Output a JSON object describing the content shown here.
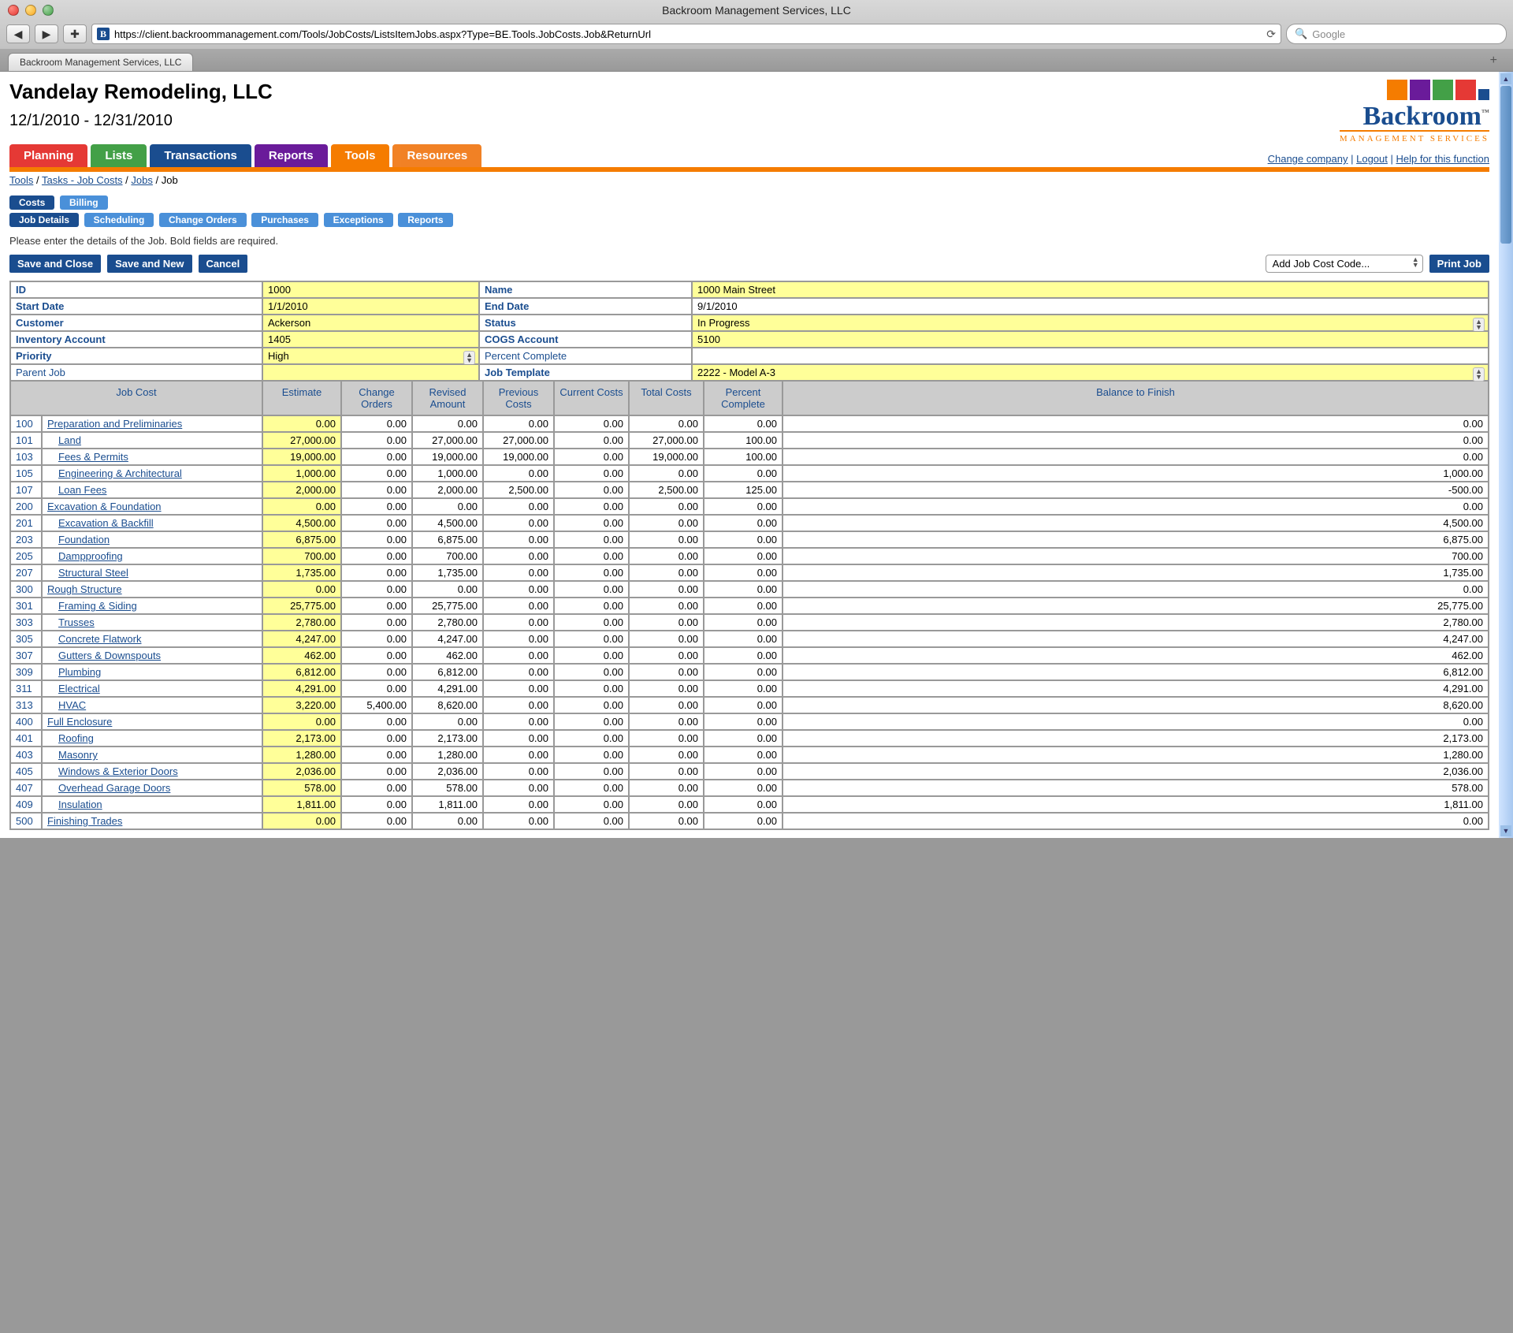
{
  "window": {
    "title": "Backroom Management Services, LLC",
    "url": "https://client.backroommanagement.com/Tools/JobCosts/ListsItemJobs.aspx?Type=BE.Tools.JobCosts.Job&ReturnUrl",
    "search_placeholder": "Google",
    "tab_label": "Backroom Management Services, LLC"
  },
  "company": "Vandelay Remodeling, LLC",
  "date_range": "12/1/2010 - 12/31/2010",
  "logo": {
    "name": "Backroom",
    "sub": "MANAGEMENT SERVICES"
  },
  "mainnav": [
    "Planning",
    "Lists",
    "Transactions",
    "Reports",
    "Tools",
    "Resources"
  ],
  "toplinks": {
    "change": "Change company",
    "logout": "Logout",
    "help": "Help for this function"
  },
  "breadcrumb": {
    "p0": "Tools",
    "p1": "Tasks - Job Costs",
    "p2": "Jobs",
    "p3": "Job"
  },
  "tabs1": {
    "costs": "Costs",
    "billing": "Billing"
  },
  "tabs2": {
    "jobdetails": "Job Details",
    "scheduling": "Scheduling",
    "changeorders": "Change Orders",
    "purchases": "Purchases",
    "exceptions": "Exceptions",
    "reports": "Reports"
  },
  "instruction": "Please enter the details of the Job. Bold fields are required.",
  "actions": {
    "save_close": "Save and Close",
    "save_new": "Save and New",
    "cancel": "Cancel",
    "add_code": "Add Job Cost Code...",
    "print": "Print Job"
  },
  "form": {
    "id_label": "ID",
    "id": "1000",
    "name_label": "Name",
    "name": "1000 Main Street",
    "start_label": "Start Date",
    "start": "1/1/2010",
    "end_label": "End Date",
    "end": "9/1/2010",
    "customer_label": "Customer",
    "customer": "Ackerson",
    "status_label": "Status",
    "status": "In Progress",
    "inv_label": "Inventory Account",
    "inv": "1405",
    "cogs_label": "COGS Account",
    "cogs": "5100",
    "priority_label": "Priority",
    "priority": "High",
    "pct_label": "Percent Complete",
    "pct": "",
    "parent_label": "Parent Job",
    "parent": "",
    "template_label": "Job Template",
    "template": "2222 - Model A-3"
  },
  "grid_headers": {
    "jobcost": "Job Cost",
    "estimate": "Estimate",
    "co": "Change Orders",
    "ra": "Revised Amount",
    "pc": "Previous Costs",
    "cc": "Current Costs",
    "tc": "Total Costs",
    "pct": "Percent Complete",
    "btf": "Balance to Finish"
  },
  "rows": [
    {
      "code": "100",
      "desc": "Preparation and Preliminaries",
      "indent": false,
      "est": "0.00",
      "co": "0.00",
      "ra": "0.00",
      "pc": "0.00",
      "cc": "0.00",
      "tc": "0.00",
      "pct": "0.00",
      "btf": "0.00"
    },
    {
      "code": "101",
      "desc": "Land",
      "indent": true,
      "est": "27,000.00",
      "co": "0.00",
      "ra": "27,000.00",
      "pc": "27,000.00",
      "cc": "0.00",
      "tc": "27,000.00",
      "pct": "100.00",
      "btf": "0.00"
    },
    {
      "code": "103",
      "desc": "Fees & Permits",
      "indent": true,
      "est": "19,000.00",
      "co": "0.00",
      "ra": "19,000.00",
      "pc": "19,000.00",
      "cc": "0.00",
      "tc": "19,000.00",
      "pct": "100.00",
      "btf": "0.00"
    },
    {
      "code": "105",
      "desc": "Engineering & Architectural",
      "indent": true,
      "est": "1,000.00",
      "co": "0.00",
      "ra": "1,000.00",
      "pc": "0.00",
      "cc": "0.00",
      "tc": "0.00",
      "pct": "0.00",
      "btf": "1,000.00"
    },
    {
      "code": "107",
      "desc": "Loan Fees",
      "indent": true,
      "est": "2,000.00",
      "co": "0.00",
      "ra": "2,000.00",
      "pc": "2,500.00",
      "cc": "0.00",
      "tc": "2,500.00",
      "pct": "125.00",
      "btf": "-500.00"
    },
    {
      "code": "200",
      "desc": "Excavation & Foundation",
      "indent": false,
      "est": "0.00",
      "co": "0.00",
      "ra": "0.00",
      "pc": "0.00",
      "cc": "0.00",
      "tc": "0.00",
      "pct": "0.00",
      "btf": "0.00"
    },
    {
      "code": "201",
      "desc": "Excavation & Backfill",
      "indent": true,
      "est": "4,500.00",
      "co": "0.00",
      "ra": "4,500.00",
      "pc": "0.00",
      "cc": "0.00",
      "tc": "0.00",
      "pct": "0.00",
      "btf": "4,500.00"
    },
    {
      "code": "203",
      "desc": "Foundation",
      "indent": true,
      "est": "6,875.00",
      "co": "0.00",
      "ra": "6,875.00",
      "pc": "0.00",
      "cc": "0.00",
      "tc": "0.00",
      "pct": "0.00",
      "btf": "6,875.00"
    },
    {
      "code": "205",
      "desc": "Dampproofing",
      "indent": true,
      "est": "700.00",
      "co": "0.00",
      "ra": "700.00",
      "pc": "0.00",
      "cc": "0.00",
      "tc": "0.00",
      "pct": "0.00",
      "btf": "700.00"
    },
    {
      "code": "207",
      "desc": "Structural Steel",
      "indent": true,
      "est": "1,735.00",
      "co": "0.00",
      "ra": "1,735.00",
      "pc": "0.00",
      "cc": "0.00",
      "tc": "0.00",
      "pct": "0.00",
      "btf": "1,735.00"
    },
    {
      "code": "300",
      "desc": "Rough Structure",
      "indent": false,
      "est": "0.00",
      "co": "0.00",
      "ra": "0.00",
      "pc": "0.00",
      "cc": "0.00",
      "tc": "0.00",
      "pct": "0.00",
      "btf": "0.00"
    },
    {
      "code": "301",
      "desc": "Framing & Siding",
      "indent": true,
      "est": "25,775.00",
      "co": "0.00",
      "ra": "25,775.00",
      "pc": "0.00",
      "cc": "0.00",
      "tc": "0.00",
      "pct": "0.00",
      "btf": "25,775.00"
    },
    {
      "code": "303",
      "desc": "Trusses",
      "indent": true,
      "est": "2,780.00",
      "co": "0.00",
      "ra": "2,780.00",
      "pc": "0.00",
      "cc": "0.00",
      "tc": "0.00",
      "pct": "0.00",
      "btf": "2,780.00"
    },
    {
      "code": "305",
      "desc": "Concrete Flatwork",
      "indent": true,
      "est": "4,247.00",
      "co": "0.00",
      "ra": "4,247.00",
      "pc": "0.00",
      "cc": "0.00",
      "tc": "0.00",
      "pct": "0.00",
      "btf": "4,247.00"
    },
    {
      "code": "307",
      "desc": "Gutters & Downspouts",
      "indent": true,
      "est": "462.00",
      "co": "0.00",
      "ra": "462.00",
      "pc": "0.00",
      "cc": "0.00",
      "tc": "0.00",
      "pct": "0.00",
      "btf": "462.00"
    },
    {
      "code": "309",
      "desc": "Plumbing",
      "indent": true,
      "est": "6,812.00",
      "co": "0.00",
      "ra": "6,812.00",
      "pc": "0.00",
      "cc": "0.00",
      "tc": "0.00",
      "pct": "0.00",
      "btf": "6,812.00"
    },
    {
      "code": "311",
      "desc": "Electrical",
      "indent": true,
      "est": "4,291.00",
      "co": "0.00",
      "ra": "4,291.00",
      "pc": "0.00",
      "cc": "0.00",
      "tc": "0.00",
      "pct": "0.00",
      "btf": "4,291.00"
    },
    {
      "code": "313",
      "desc": "HVAC",
      "indent": true,
      "est": "3,220.00",
      "co": "5,400.00",
      "ra": "8,620.00",
      "pc": "0.00",
      "cc": "0.00",
      "tc": "0.00",
      "pct": "0.00",
      "btf": "8,620.00"
    },
    {
      "code": "400",
      "desc": "Full Enclosure",
      "indent": false,
      "est": "0.00",
      "co": "0.00",
      "ra": "0.00",
      "pc": "0.00",
      "cc": "0.00",
      "tc": "0.00",
      "pct": "0.00",
      "btf": "0.00"
    },
    {
      "code": "401",
      "desc": "Roofing",
      "indent": true,
      "est": "2,173.00",
      "co": "0.00",
      "ra": "2,173.00",
      "pc": "0.00",
      "cc": "0.00",
      "tc": "0.00",
      "pct": "0.00",
      "btf": "2,173.00"
    },
    {
      "code": "403",
      "desc": "Masonry",
      "indent": true,
      "est": "1,280.00",
      "co": "0.00",
      "ra": "1,280.00",
      "pc": "0.00",
      "cc": "0.00",
      "tc": "0.00",
      "pct": "0.00",
      "btf": "1,280.00"
    },
    {
      "code": "405",
      "desc": "Windows & Exterior Doors",
      "indent": true,
      "est": "2,036.00",
      "co": "0.00",
      "ra": "2,036.00",
      "pc": "0.00",
      "cc": "0.00",
      "tc": "0.00",
      "pct": "0.00",
      "btf": "2,036.00"
    },
    {
      "code": "407",
      "desc": "Overhead Garage Doors",
      "indent": true,
      "est": "578.00",
      "co": "0.00",
      "ra": "578.00",
      "pc": "0.00",
      "cc": "0.00",
      "tc": "0.00",
      "pct": "0.00",
      "btf": "578.00"
    },
    {
      "code": "409",
      "desc": "Insulation",
      "indent": true,
      "est": "1,811.00",
      "co": "0.00",
      "ra": "1,811.00",
      "pc": "0.00",
      "cc": "0.00",
      "tc": "0.00",
      "pct": "0.00",
      "btf": "1,811.00"
    },
    {
      "code": "500",
      "desc": "Finishing Trades",
      "indent": false,
      "est": "0.00",
      "co": "0.00",
      "ra": "0.00",
      "pc": "0.00",
      "cc": "0.00",
      "tc": "0.00",
      "pct": "0.00",
      "btf": "0.00"
    }
  ]
}
